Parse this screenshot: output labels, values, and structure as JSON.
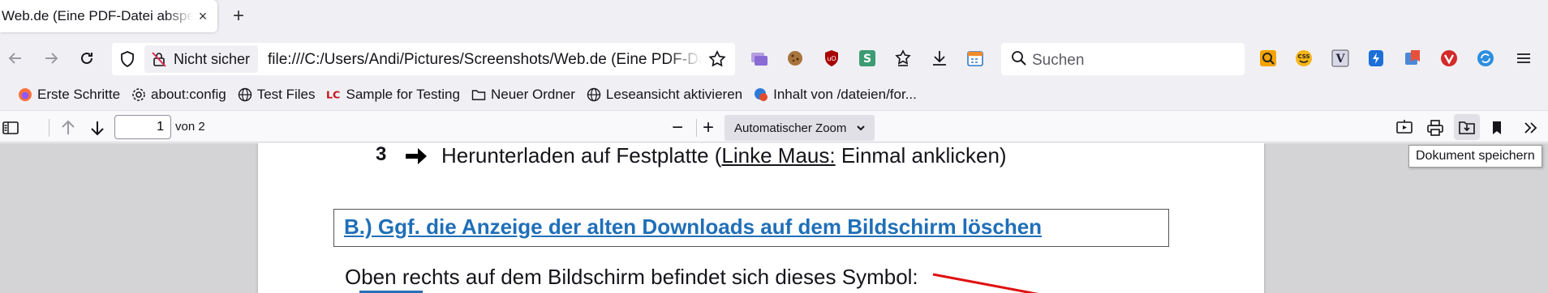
{
  "tab": {
    "title": "Web.de (Eine PDF-Datei abspeichern)",
    "close": "×",
    "new_tab": "+"
  },
  "nav": {
    "site_identity": "Nicht sicher",
    "url": "file:///C:/Users/Andi/Pictures/Screenshots/Web.de (Eine PDF-Datei abspeichern).pdf",
    "search_placeholder": "Suchen"
  },
  "bookmarks": [
    {
      "label": "Erste Schritte",
      "icon": "firefox-icon"
    },
    {
      "label": "about:config",
      "icon": "gear-icon"
    },
    {
      "label": "Test Files",
      "icon": "globe-icon"
    },
    {
      "label": "Sample for Testing",
      "icon": "lc-icon"
    },
    {
      "label": "Neuer Ordner",
      "icon": "folder-icon"
    },
    {
      "label": "Leseansicht aktivieren",
      "icon": "globe-icon"
    },
    {
      "label": "Inhalt von /dateien/for...",
      "icon": "extension-icon"
    }
  ],
  "pdf_toolbar": {
    "page_number": "1",
    "page_of": "von 2",
    "zoom_label": "Automatischer Zoom",
    "zoom_out": "−",
    "zoom_in": "+"
  },
  "document": {
    "step_number": "3",
    "step_pre": "Herunterladen auf Festplatte (",
    "step_link": "Linke Maus:",
    "step_post": " Einmal anklicken)",
    "heading": "B.)  Ggf. die Anzeige der alten Downloads auf dem Bildschirm löschen",
    "body": "Oben rechts auf dem Bildschirm befindet sich dieses Symbol:"
  },
  "tooltip": "Dokument speichern",
  "colors": {
    "heading_blue": "#1f6fb8",
    "annotation_red": "#e01010",
    "tab_bg": "#ffffff",
    "chrome_bg": "#f0f0f4"
  }
}
